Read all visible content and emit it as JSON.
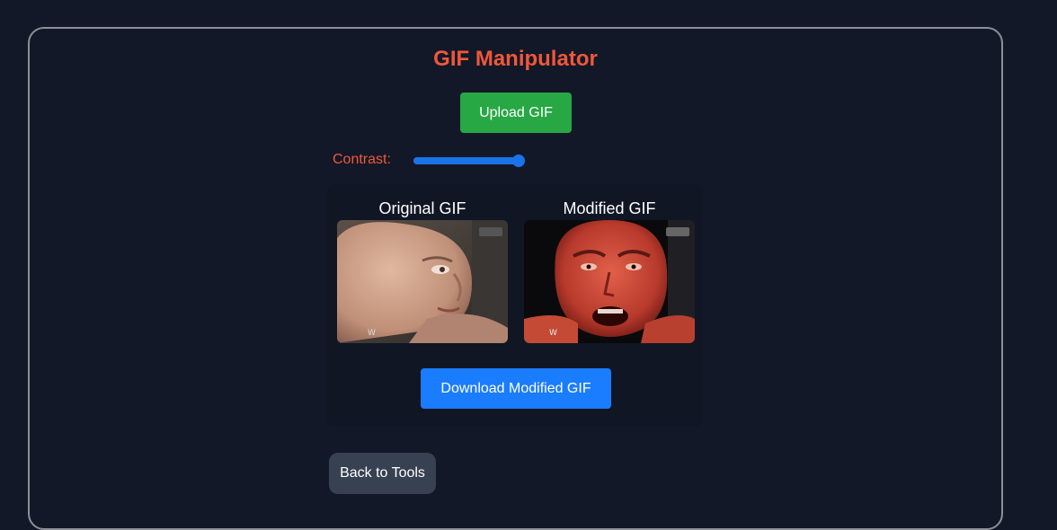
{
  "app": {
    "title": "GIF Manipulator",
    "upload_label": "Upload GIF",
    "contrast": {
      "label": "Contrast:",
      "value_fraction": 1.0
    },
    "preview": {
      "original_caption": "Original GIF",
      "modified_caption": "Modified GIF",
      "download_label": "Download Modified GIF"
    },
    "back_label": "Back to Tools"
  },
  "colors": {
    "background": "#121827",
    "accent_title": "#f0573b",
    "upload_button": "#28a745",
    "download_button": "#1a7cff",
    "slider": "#1a73e8",
    "back_button": "#374151"
  }
}
